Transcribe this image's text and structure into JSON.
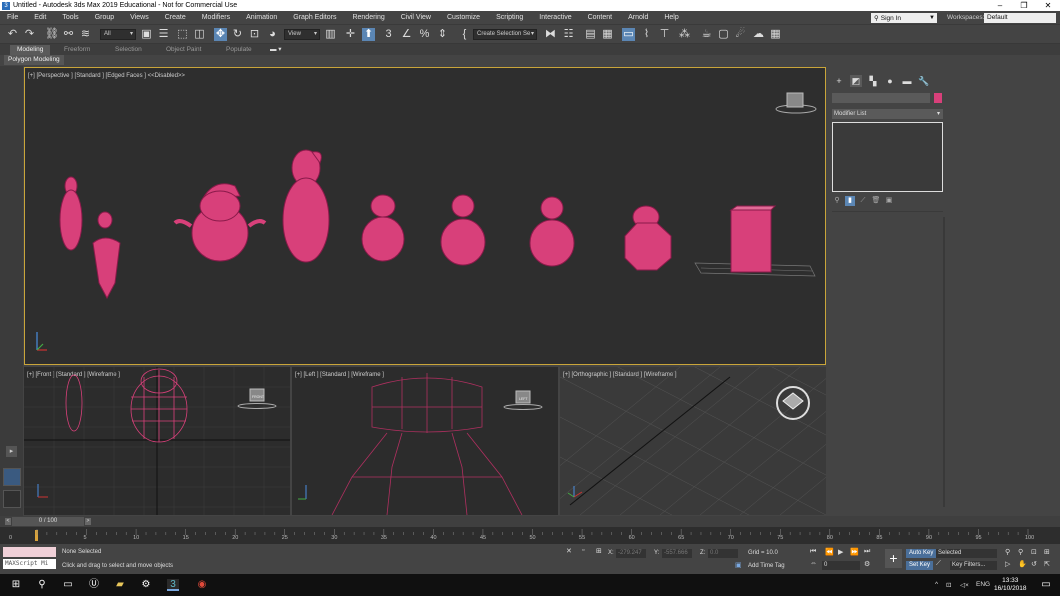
{
  "window": {
    "title": "Untitled - Autodesk 3ds Max 2019 Educational - Not for Commercial Use",
    "controls": [
      "–",
      "❐",
      "✕"
    ]
  },
  "menu": [
    "File",
    "Edit",
    "Tools",
    "Group",
    "Views",
    "Create",
    "Modifiers",
    "Animation",
    "Graph Editors",
    "Rendering",
    "Civil View",
    "Customize",
    "Scripting",
    "Interactive",
    "Content",
    "Arnold",
    "Help"
  ],
  "account": {
    "sign_in": "Sign In",
    "workspaces_label": "Workspaces:",
    "workspace": "Default"
  },
  "toolbar": {
    "filter": "All",
    "ref_coord": "View",
    "named_selection": "Create Selection Se"
  },
  "ribbon": {
    "tabs": [
      "Modeling",
      "Freeform",
      "Selection",
      "Object Paint",
      "Populate"
    ],
    "active_tab": "Modeling",
    "sub_label": "Polygon Modeling"
  },
  "viewports": {
    "perspective": "[+] [Perspective ] [Standard ] [Edged Faces ] <<Disabled>>",
    "front": "[+] [Front ] [Standard ] [Wireframe ]",
    "left": "[+] [Left ] [Standard ] [Wireframe ]",
    "ortho": "[+] [Orthographic ] [Standard ] [Wireframe ]",
    "front_cube": "FRONT",
    "left_cube": "LEFT"
  },
  "command_panel": {
    "modifier_list": "Modifier List",
    "object_color": "#d8407a"
  },
  "time": {
    "frame_display": "0 / 100",
    "ticks": [
      "5",
      "10",
      "15",
      "20",
      "25",
      "30",
      "35",
      "40",
      "45",
      "50",
      "55",
      "60",
      "65",
      "70",
      "75",
      "80",
      "85",
      "90",
      "95",
      "100"
    ],
    "first_tick": "0"
  },
  "status": {
    "maxscript": "MAXScript Mi",
    "selection": "None Selected",
    "prompt": "Click and drag to select and move objects",
    "x_label": "X:",
    "x_value": "-279.247",
    "y_label": "Y:",
    "y_value": "-557.666",
    "z_label": "Z:",
    "z_value": "0.0",
    "grid": "Grid = 10.0",
    "add_time_tag": "Add Time Tag",
    "current_frame": "0",
    "auto_key": "Auto Key",
    "set_key": "Set Key",
    "selected": "Selected",
    "key_filters": "Key Filters..."
  },
  "taskbar": {
    "lang": "ENG",
    "time": "13:33",
    "date": "16/10/2018"
  },
  "colors": {
    "mesh": "#d8407a",
    "active_border": "#c9a53a",
    "accent": "#5b86b4"
  }
}
